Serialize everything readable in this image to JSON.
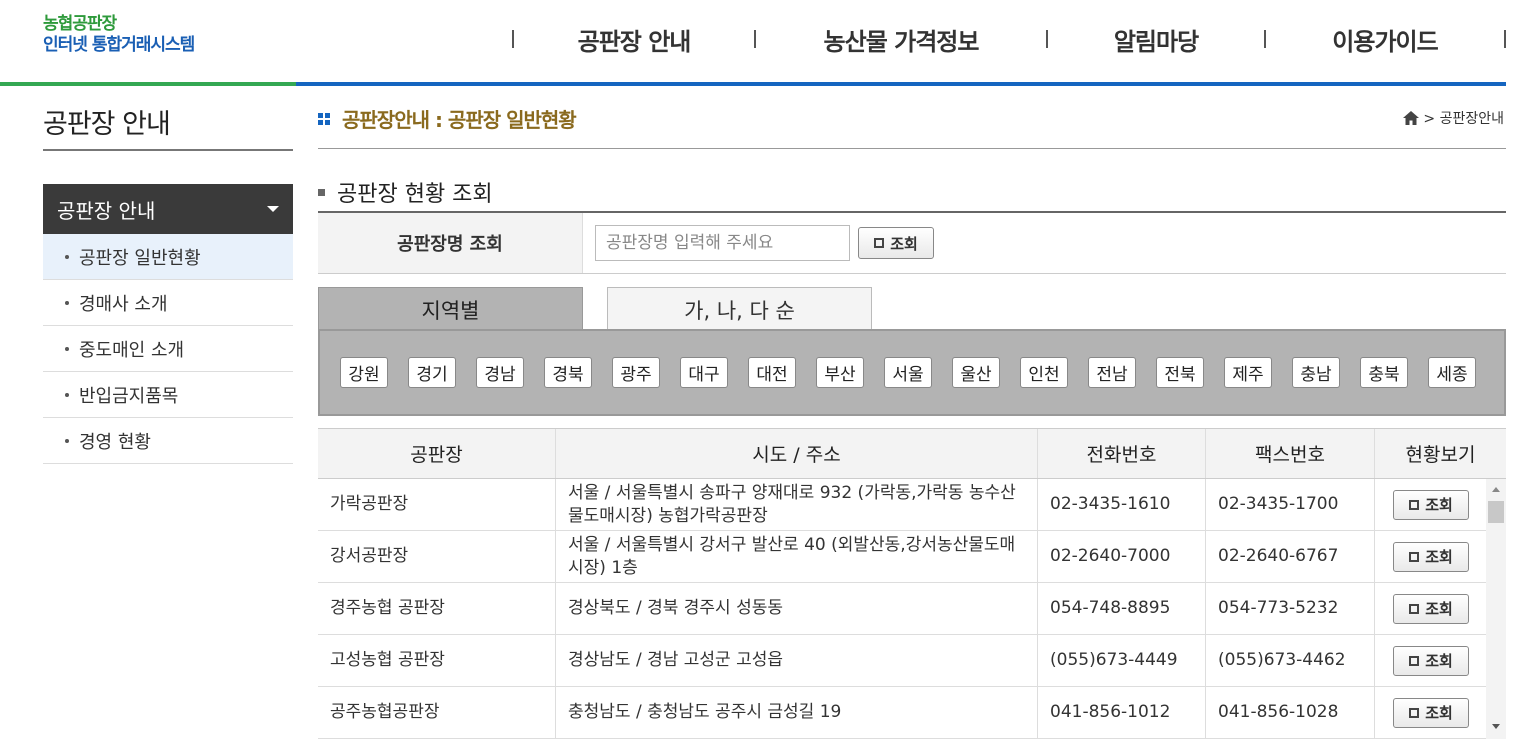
{
  "header": {
    "logo_line1": "농협공판장",
    "logo_line2": "인터넷 통합거래시스템",
    "nav": [
      "공판장 안내",
      "농산물 가격정보",
      "알림마당",
      "이용가이드"
    ]
  },
  "sidebar": {
    "title": "공판장 안내",
    "menu_head": "공판장 안내",
    "items": [
      "공판장 일반현황",
      "경매사 소개",
      "중도매인 소개",
      "반입금지품목",
      "경영 현황"
    ],
    "active_index": 0
  },
  "content": {
    "title": "공판장안내 : 공판장 일반현황",
    "breadcrumb": "> 공판장안내",
    "section_title": "공판장 현황 조회",
    "search_label": "공판장명 조회",
    "search_placeholder": "공판장명 입력해 주세요",
    "search_button": "조회",
    "tabs": [
      "지역별",
      "가, 나, 다 순"
    ],
    "regions": [
      "강원",
      "경기",
      "경남",
      "경북",
      "광주",
      "대구",
      "대전",
      "부산",
      "서울",
      "울산",
      "인천",
      "전남",
      "전북",
      "제주",
      "충남",
      "충북",
      "세종"
    ]
  },
  "table": {
    "headers": [
      "공판장",
      "시도 / 주소",
      "전화번호",
      "팩스번호",
      "현황보기"
    ],
    "rows": [
      {
        "name": "가락공판장",
        "address": "서울 / 서울특별시 송파구 양재대로 932 (가락동,가락동 농수산물도매시장) 농협가락공판장",
        "phone": "02-3435-1610",
        "fax": "02-3435-1700",
        "button": "조회"
      },
      {
        "name": "강서공판장",
        "address": "서울 / 서울특별시 강서구 발산로 40 (외발산동,강서농산물도매시장) 1층",
        "phone": "02-2640-7000",
        "fax": "02-2640-6767",
        "button": "조회"
      },
      {
        "name": "경주농협 공판장",
        "address": "경상북도 / 경북 경주시 성동동",
        "phone": "054-748-8895",
        "fax": "054-773-5232",
        "button": "조회"
      },
      {
        "name": "고성농협 공판장",
        "address": "경상남도 / 경남 고성군 고성읍",
        "phone": "(055)673-4449",
        "fax": "(055)673-4462",
        "button": "조회"
      },
      {
        "name": "공주농협공판장",
        "address": "충청남도 / 충청남도 공주시 금성길 19",
        "phone": "041-856-1012",
        "fax": "041-856-1028",
        "button": "조회"
      }
    ]
  }
}
